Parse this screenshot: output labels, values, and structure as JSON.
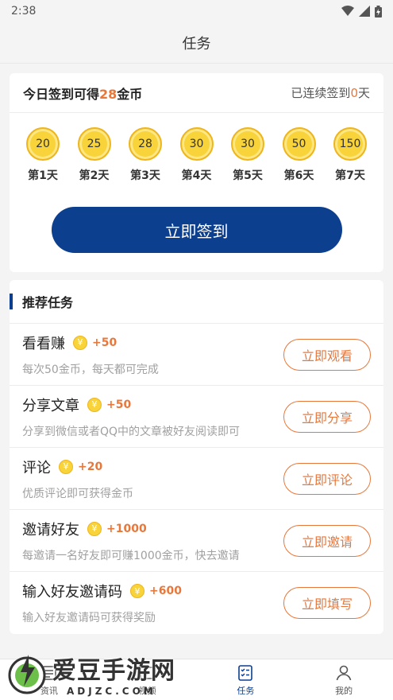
{
  "status": {
    "time": "2:38"
  },
  "header": {
    "title": "任务"
  },
  "checkin": {
    "prefix": "今日签到可得",
    "today_reward": "28",
    "suffix": "金币",
    "streak_prefix": "已连续签到",
    "streak_days": "0",
    "streak_suffix": "天",
    "days": [
      {
        "coins": "20",
        "label": "第1天"
      },
      {
        "coins": "25",
        "label": "第2天"
      },
      {
        "coins": "28",
        "label": "第3天"
      },
      {
        "coins": "30",
        "label": "第4天"
      },
      {
        "coins": "30",
        "label": "第5天"
      },
      {
        "coins": "50",
        "label": "第6天"
      },
      {
        "coins": "150",
        "label": "第7天"
      }
    ],
    "button": "立即签到"
  },
  "tasks": {
    "title": "推荐任务",
    "items": [
      {
        "name": "看看赚",
        "reward": "+50",
        "desc": "每次50金币，每天都可完成",
        "button": "立即观看"
      },
      {
        "name": "分享文章",
        "reward": "+50",
        "desc": "分享到微信或者QQ中的文章被好友阅读即可",
        "button": "立即分享"
      },
      {
        "name": "评论",
        "reward": "+20",
        "desc": "优质评论即可获得金币",
        "button": "立即评论"
      },
      {
        "name": "邀请好友",
        "reward": "+1000",
        "desc": "每邀请一名好友即可赚1000金币，快去邀请",
        "button": "立即邀请"
      },
      {
        "name": "输入好友邀请码",
        "reward": "+600",
        "desc": "输入好友邀请码可获得奖励",
        "button": "立即填写"
      }
    ]
  },
  "tabbar": {
    "items": [
      {
        "label": "资讯"
      },
      {
        "label": "视频"
      },
      {
        "label": "任务"
      },
      {
        "label": "我的"
      }
    ]
  },
  "watermark": {
    "title": "爱豆手游网",
    "sub": "ADJZC.COM"
  },
  "colors": {
    "primary": "#0d3f8f",
    "accent": "#e8773a",
    "coin": "#f8d33a"
  }
}
